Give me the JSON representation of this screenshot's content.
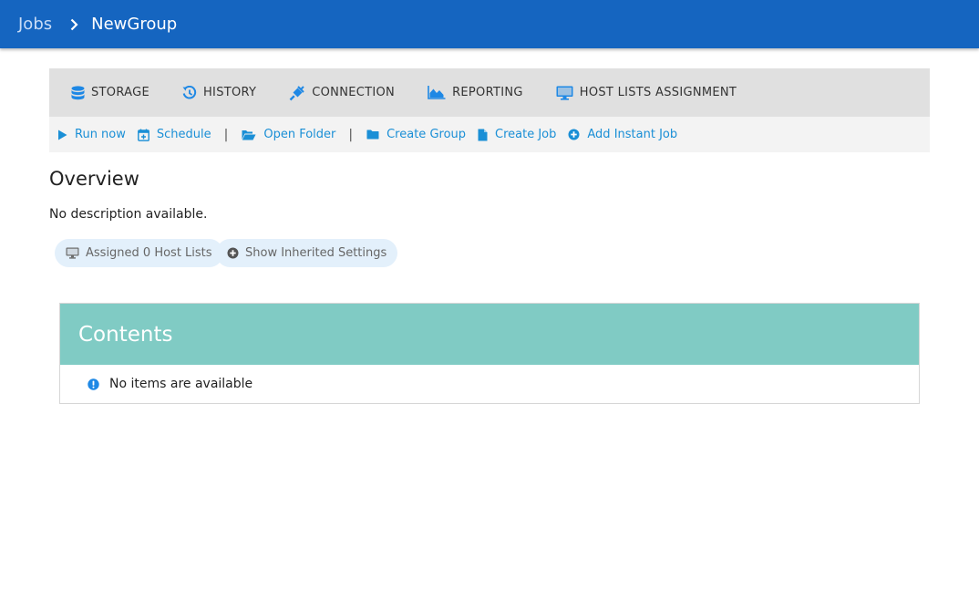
{
  "breadcrumb": {
    "parent": "Jobs",
    "current": "NewGroup"
  },
  "tabs": [
    {
      "label": "STORAGE",
      "icon": "database-icon"
    },
    {
      "label": "HISTORY",
      "icon": "history-icon"
    },
    {
      "label": "CONNECTION",
      "icon": "plug-icon"
    },
    {
      "label": "REPORTING",
      "icon": "area-chart-icon"
    },
    {
      "label": "HOST LISTS ASSIGNMENT",
      "icon": "monitor-icon"
    }
  ],
  "actions": {
    "run_now": "Run now",
    "schedule": "Schedule",
    "open_folder": "Open Folder",
    "create_group": "Create Group",
    "create_job": "Create Job",
    "add_instant_job": "Add Instant Job",
    "separator": "|"
  },
  "overview": {
    "title": "Overview",
    "description": "No description available.",
    "assigned_pill": "Assigned 0 Host Lists",
    "inherited_pill": "Show Inherited Settings"
  },
  "contents": {
    "title": "Contents",
    "empty_message": "No items are available"
  },
  "colors": {
    "topbar": "#1565c0",
    "link": "#1a8fd6",
    "icon_blue": "#1e88e5",
    "panel_header": "#80cbc4",
    "pill_bg": "#e3f0fb"
  }
}
